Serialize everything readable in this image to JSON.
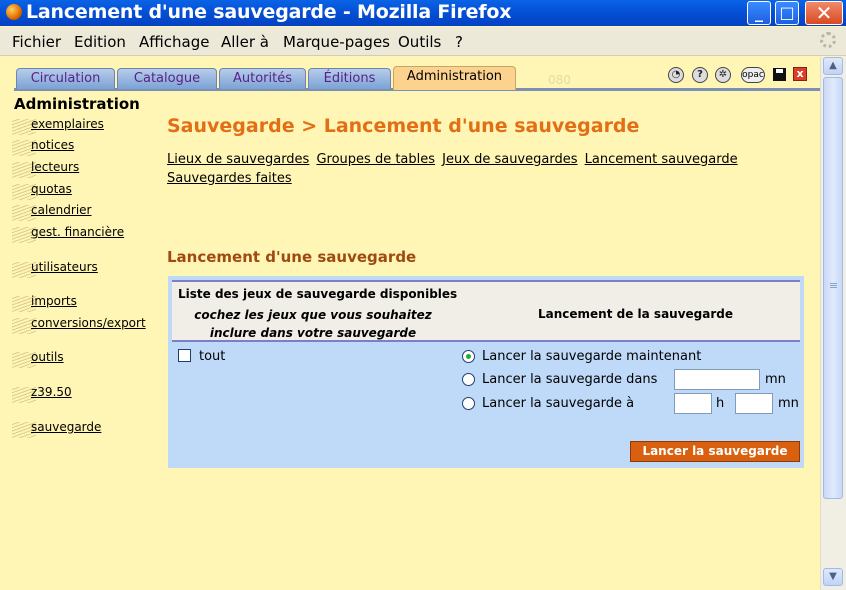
{
  "window": {
    "title": "Lancement d'une sauvegarde - Mozilla Firefox",
    "minimize": "_",
    "maximize": "□",
    "close": "✕"
  },
  "menu": [
    {
      "name": "fichier",
      "label": "Fichier"
    },
    {
      "name": "edition",
      "label": "Edition"
    },
    {
      "name": "affichage",
      "label": "Affichage"
    },
    {
      "name": "aller-a",
      "label": "Aller à"
    },
    {
      "name": "marque-pages",
      "label": "Marque-pages"
    },
    {
      "name": "outils",
      "label": "Outils"
    },
    {
      "name": "aide",
      "label": "?"
    }
  ],
  "tabs": [
    {
      "label": "Circulation",
      "active": false
    },
    {
      "label": "Catalogue",
      "active": false
    },
    {
      "label": "Autorités",
      "active": false
    },
    {
      "label": "Éditions",
      "active": false
    },
    {
      "label": "Administration",
      "active": true
    }
  ],
  "ghost_number": "080",
  "toolbar_icons": {
    "opac": "opac",
    "help": "?",
    "close": "x"
  },
  "sidebar": {
    "title": "Administration",
    "items": [
      {
        "name": "exemplaires",
        "label": "exemplaires"
      },
      {
        "name": "notices",
        "label": "notices"
      },
      {
        "name": "lecteurs",
        "label": "lecteurs"
      },
      {
        "name": "quotas",
        "label": "quotas"
      },
      {
        "name": "calendrier",
        "label": "calendrier"
      },
      {
        "name": "gest-financiere",
        "label": "gest. financière"
      },
      {
        "name": "utilisateurs",
        "label": "utilisateurs"
      },
      {
        "name": "imports",
        "label": "imports"
      },
      {
        "name": "conversions-export",
        "label": "conversions/export"
      },
      {
        "name": "outils",
        "label": "outils"
      },
      {
        "name": "z3950",
        "label": "z39.50"
      },
      {
        "name": "sauvegarde",
        "label": "sauvegarde"
      }
    ]
  },
  "main": {
    "page_title": "Sauvegarde > Lancement d'une sauvegarde",
    "links": [
      "Lieux de sauvegardes",
      "Groupes de tables",
      "Jeux de sauvegardes",
      "Lancement sauvegarde",
      "Sauvegardes faites"
    ],
    "section_title": "Lancement d'une sauvegarde",
    "form": {
      "col1_title": "Liste des jeux de sauvegarde disponibles",
      "col1_sub_line1": "cochez les jeux que vous souhaitez",
      "col1_sub_line2": "inclure dans votre sauvegarde",
      "col2_title": "Lancement de la sauvegarde",
      "tout_label": "tout",
      "tout_checked": false,
      "option_now": "Lancer la sauvegarde maintenant",
      "option_in": "Lancer la sauvegarde dans",
      "option_at": "Lancer la sauvegarde à",
      "selected_option": "now",
      "unit_mn": "mn",
      "unit_h": "h",
      "field_minutes_value": "",
      "field_hour_value": "",
      "field_minute_value": "",
      "submit_label": "Lancer la sauvegarde"
    }
  },
  "colors": {
    "page_background": "#fff5b4",
    "title_orange": "#e26f16",
    "section_brown": "#9e4a12",
    "form_blue": "#bfd9f8",
    "submit_orange": "#d9600f"
  }
}
